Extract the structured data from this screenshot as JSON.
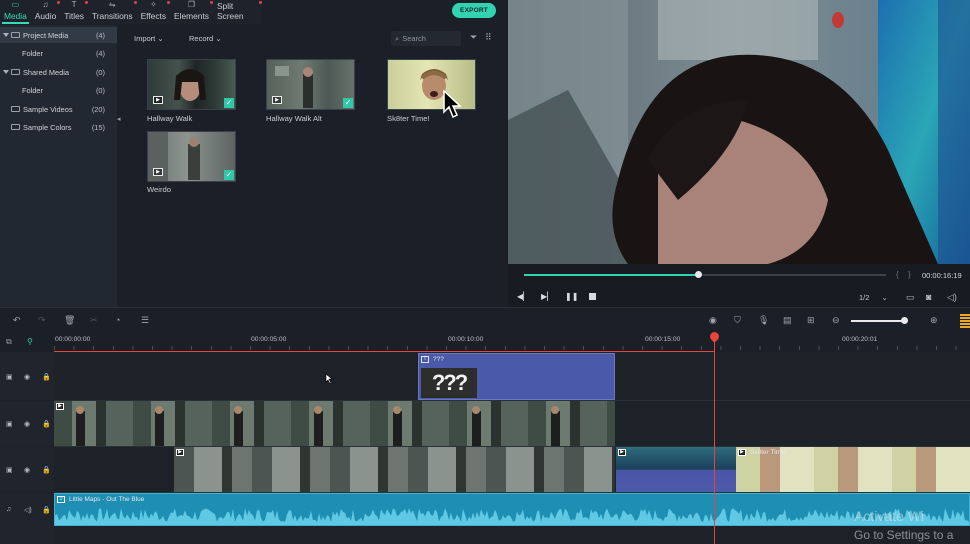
{
  "nav": {
    "tabs": [
      {
        "label": "Media",
        "icon": "folder-icon"
      },
      {
        "label": "Audio",
        "icon": "music-note-icon"
      },
      {
        "label": "Titles",
        "icon": "text-icon"
      },
      {
        "label": "Transitions",
        "icon": "transition-icon"
      },
      {
        "label": "Effects",
        "icon": "effects-icon"
      },
      {
        "label": "Elements",
        "icon": "elements-icon"
      },
      {
        "label": "Split Screen",
        "icon": "split-screen-icon"
      }
    ],
    "export_label": "EXPORT"
  },
  "sidebar": {
    "items": [
      {
        "label": "Project Media",
        "count": "(4)"
      },
      {
        "label": "Folder",
        "count": "(4)"
      },
      {
        "label": "Shared Media",
        "count": "(0)"
      },
      {
        "label": "Folder",
        "count": "(0)"
      },
      {
        "label": "Sample Videos",
        "count": "(20)"
      },
      {
        "label": "Sample Colors",
        "count": "(15)"
      }
    ]
  },
  "media_toolbar": {
    "import_label": "Import",
    "record_label": "Record",
    "search_placeholder": "Search"
  },
  "media_items": [
    {
      "label": "Hallway Walk"
    },
    {
      "label": "Hallway Walk Alt"
    },
    {
      "label": "Sk8ter Time!"
    },
    {
      "label": "Weirdo"
    }
  ],
  "player": {
    "timecode": "00:00:16:19",
    "progress": 0.48,
    "zoom_ratio": "1/2"
  },
  "timeline": {
    "ruler_labels": [
      "00:00:00:00",
      "00:00:05:00",
      "00:00:10:00",
      "00:00:15:00",
      "00:00:20:01"
    ],
    "clips": {
      "title_clip": "???",
      "title_overlay": "???",
      "clip_sk8ter": "Sk8ter Time!",
      "audio_clip": "Little Maps - Out The Blue"
    }
  },
  "watermark": {
    "line1": "Activate Wi",
    "line2": "Go to Settings to a"
  },
  "colors": {
    "accent": "#33d2b0",
    "playhead": "#e8443c",
    "title_clip": "#4b5aa8",
    "audio_clip": "#1e8fb3"
  }
}
